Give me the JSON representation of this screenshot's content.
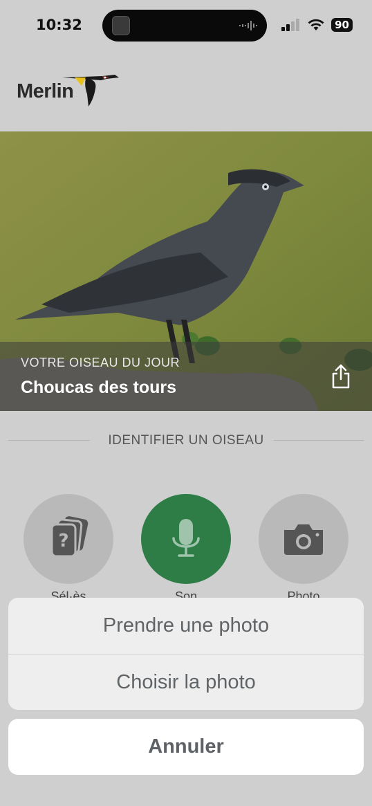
{
  "status_bar": {
    "time": "10:32",
    "battery": "90"
  },
  "header": {
    "logo_text": "Merlin"
  },
  "hero": {
    "label": "VOTRE OISEAU DU JOUR",
    "bird_name": "Choucas des tours"
  },
  "identify": {
    "title": "IDENTIFIER UN OISEAU",
    "buttons": [
      {
        "icon": "question-cards-icon",
        "label": "Sél·ès"
      },
      {
        "icon": "microphone-icon",
        "label": "Son"
      },
      {
        "icon": "camera-icon",
        "label": "Photo"
      }
    ]
  },
  "action_sheet": {
    "options": [
      "Prendre une photo",
      "Choisir la photo"
    ],
    "cancel": "Annuler"
  },
  "colors": {
    "accent_green": "#2e7d47",
    "overlay_grey": "#cfcfcf"
  }
}
